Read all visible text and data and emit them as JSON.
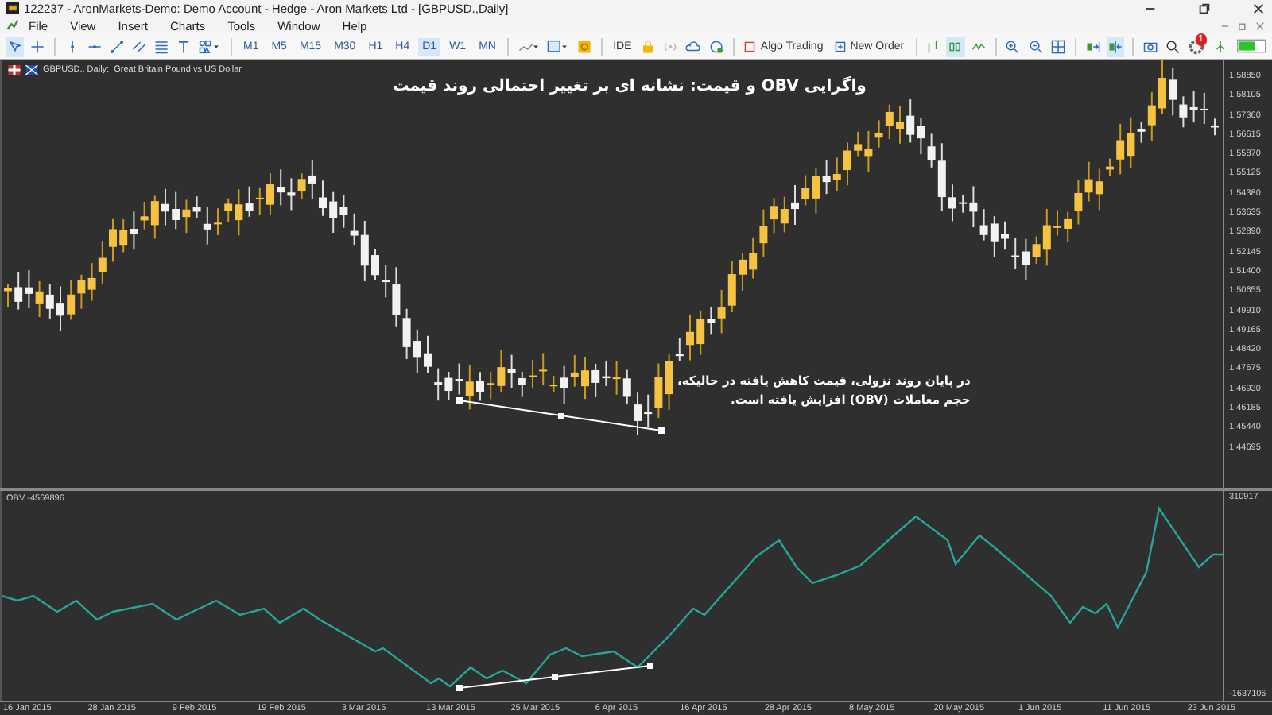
{
  "window": {
    "title": "122237 - AronMarkets-Demo: Demo Account - Hedge - Aron Markets Ltd - [GBPUSD.,Daily]"
  },
  "menu": [
    "File",
    "View",
    "Insert",
    "Charts",
    "Tools",
    "Window",
    "Help"
  ],
  "toolbar": {
    "timeframes": [
      {
        "label": "M1",
        "selected": false
      },
      {
        "label": "M5",
        "selected": false
      },
      {
        "label": "M15",
        "selected": false
      },
      {
        "label": "M30",
        "selected": false
      },
      {
        "label": "H1",
        "selected": false
      },
      {
        "label": "H4",
        "selected": false
      },
      {
        "label": "D1",
        "selected": true
      },
      {
        "label": "W1",
        "selected": false
      },
      {
        "label": "MN",
        "selected": false
      }
    ],
    "ide": "IDE",
    "algo_trading": "Algo Trading",
    "new_order": "New Order",
    "notifications": "1"
  },
  "chart": {
    "header": "GBPUSD., Daily:  Great Britain Pound vs US Dollar",
    "title": "واگرایی OBV و قیمت: نشانه ای بر تغییر احتمالی روند قیمت",
    "note_lines": [
      "در پایان روند نزولی، قیمت کاهش یافته در حالیکه،",
      "حجم معاملات (OBV) افزایش یافته است."
    ],
    "price_ticks": [
      "1.58850",
      "1.58105",
      "1.57360",
      "1.56615",
      "1.55870",
      "1.55125",
      "1.54380",
      "1.53635",
      "1.52890",
      "1.52145",
      "1.51400",
      "1.50655",
      "1.49910",
      "1.49165",
      "1.48420",
      "1.47675",
      "1.46930",
      "1.46185",
      "1.45440",
      "1.44695"
    ],
    "indicator": {
      "label": "OBV -4569896",
      "top_tick": "310917",
      "bottom_tick": "-1637106"
    },
    "time_labels": [
      "16 Jan 2015",
      "28 Jan 2015",
      "9 Feb 2015",
      "19 Feb 2015",
      "3 Mar 2015",
      "13 Mar 2015",
      "25 Mar 2015",
      "6 Apr 2015",
      "16 Apr 2015",
      "28 Apr 2015",
      "8 May 2015",
      "20 May 2015",
      "1 Jun 2015",
      "11 Jun 2015",
      "23 Jun 2015"
    ]
  }
}
